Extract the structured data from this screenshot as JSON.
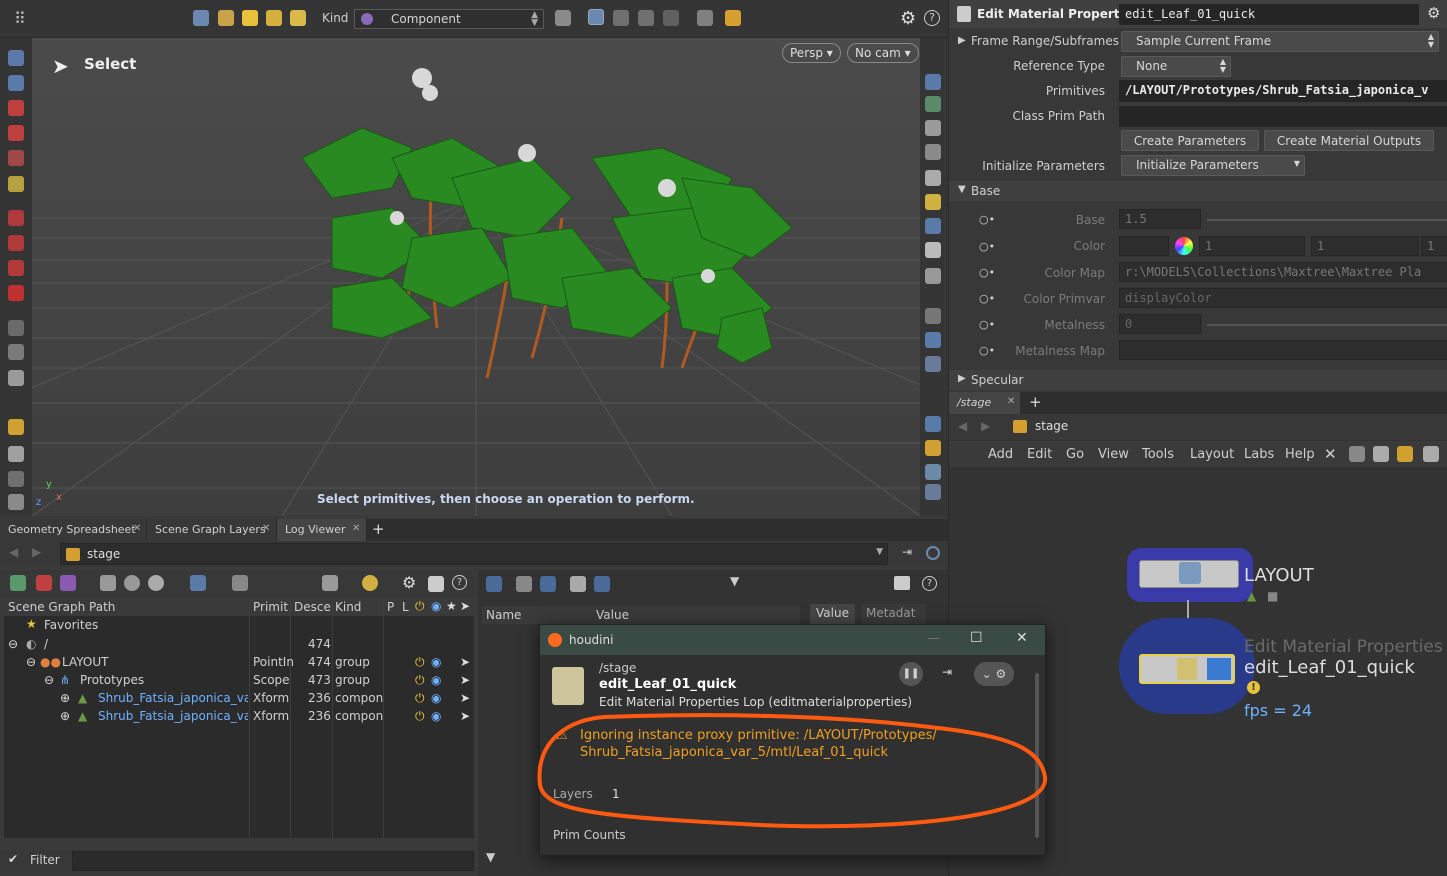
{
  "toolbar": {
    "kind_label": "Kind",
    "kind_value": "Component"
  },
  "viewport": {
    "tool_label": "Select",
    "persp_button": "Persp ▾",
    "cam_button": "No cam ▾",
    "hint": "Select primitives, then choose an operation to perform.",
    "axis_x": "x",
    "axis_y": "y",
    "axis_z": "z"
  },
  "bottom_tabs": [
    "Geometry Spreadsheet",
    "Scene Graph Layers",
    "Log Viewer"
  ],
  "path_bar": {
    "value": "stage"
  },
  "scene_graph": {
    "headers": [
      "Scene Graph Path",
      "Primit",
      "Desce",
      "Kind",
      "P",
      "L"
    ],
    "favorites": "Favorites",
    "rows": [
      {
        "name": "/",
        "prim": "",
        "desc": "474",
        "kind": ""
      },
      {
        "name": "LAYOUT",
        "prim": "PointIn",
        "desc": "474",
        "kind": "group"
      },
      {
        "name": "Prototypes",
        "prim": "Scope",
        "desc": "473",
        "kind": "group"
      },
      {
        "name": "Shrub_Fatsia_japonica_var",
        "prim": "Xform",
        "desc": "236",
        "kind": "compon"
      },
      {
        "name": "Shrub_Fatsia_japonica_var",
        "prim": "Xform",
        "desc": "236",
        "kind": "compon"
      }
    ],
    "filter_label": "Filter"
  },
  "mid_panel": {
    "col_name": "Name",
    "col_value": "Value",
    "tab_value": "Value",
    "tab_meta": "Metadat"
  },
  "params": {
    "title": "Edit Material Properties",
    "node_name": "edit_Leaf_01_quick",
    "frame_range_label": "Frame Range/Subframes",
    "frame_range_value": "Sample Current Frame",
    "ref_type_label": "Reference Type",
    "ref_type_value": "None",
    "primitives_label": "Primitives",
    "primitives_value": "/LAYOUT/Prototypes/Shrub_Fatsia_japonica_v",
    "class_prim_label": "Class Prim Path",
    "create_params_btn": "Create Parameters",
    "create_outputs_btn": "Create Material Outputs",
    "init_label": "Initialize Parameters",
    "init_value": "Initialize Parameters",
    "base_section": "Base",
    "base_label": "Base",
    "base_value": "1.5",
    "color_label": "Color",
    "color_r": "1",
    "color_g": "1",
    "color_b": "1",
    "colormap_label": "Color Map",
    "colormap_value": "r:\\MODELS\\Collections\\Maxtree\\Maxtree Pla",
    "primvar_label": "Color Primvar",
    "primvar_value": "displayColor",
    "metal_label": "Metalness",
    "metal_value": "0",
    "metalmap_label": "Metalness Map",
    "specular_section": "Specular"
  },
  "network": {
    "tab": "/stage",
    "path": "stage",
    "menu": [
      "Add",
      "Edit",
      "Go",
      "View",
      "Tools",
      "Layout",
      "Labs",
      "Help"
    ],
    "node1_name": "LAYOUT",
    "node2_type": "Edit Material Properties",
    "node2_name": "edit_Leaf_01_quick",
    "fps": "fps = 24"
  },
  "dialog": {
    "app": "houdini",
    "context": "/stage",
    "node": "edit_Leaf_01_quick",
    "desc": "Edit Material Properties Lop (editmaterialproperties)",
    "warning_line1": "Ignoring instance proxy primitive: /LAYOUT/Prototypes/",
    "warning_line2": "Shrub_Fatsia_japonica_var_5/mtl/Leaf_01_quick",
    "layers_label": "Layers",
    "layers_value": "1",
    "prim_counts": "Prim Counts"
  },
  "colors": {
    "accent_yellow": "#e8c23a",
    "warning": "#f0a020",
    "annotation_orange": "#ff5a10",
    "node_blue": "#3a3aa8",
    "link_blue": "#6fb1ff"
  }
}
